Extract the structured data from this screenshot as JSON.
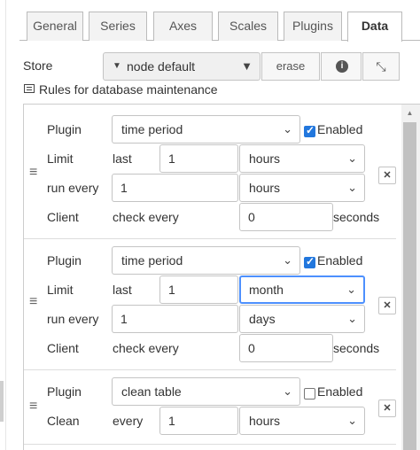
{
  "tabs": [
    {
      "label": "General"
    },
    {
      "label": "Series"
    },
    {
      "label": "Axes"
    },
    {
      "label": "Scales"
    },
    {
      "label": "Plugins"
    },
    {
      "label": "Data"
    }
  ],
  "store": {
    "label": "Store",
    "value": "node  default",
    "erase_label": "erase",
    "info_icon": "info-icon",
    "collapse_icon": "collapse-icon"
  },
  "rules_title": "Rules for database maintenance",
  "rules": [
    {
      "plugin_label": "Plugin",
      "plugin_value": "time period",
      "enabled": true,
      "enabled_label": "Enabled",
      "limit_label": "Limit",
      "limit_text": "last",
      "limit_value": "1",
      "limit_unit": "hours",
      "run_label": "run every",
      "run_value": "1",
      "run_unit": "hours",
      "client_label": "Client",
      "client_text": "check every",
      "client_value": "0",
      "client_unit": "seconds"
    },
    {
      "plugin_label": "Plugin",
      "plugin_value": "time period",
      "enabled": true,
      "enabled_label": "Enabled",
      "limit_label": "Limit",
      "limit_text": "last",
      "limit_value": "1",
      "limit_unit": "month",
      "run_label": "run every",
      "run_value": "1",
      "run_unit": "days",
      "client_label": "Client",
      "client_text": "check every",
      "client_value": "0",
      "client_unit": "seconds"
    },
    {
      "plugin_label": "Plugin",
      "plugin_value": "clean table",
      "enabled": false,
      "enabled_label": "Enabled",
      "clean_label": "Clean",
      "clean_text": "every",
      "clean_value": "1",
      "clean_unit": "hours"
    }
  ],
  "colors": {
    "checkbox_on": "#2277dd",
    "focus_outline": "#4d90fe"
  }
}
